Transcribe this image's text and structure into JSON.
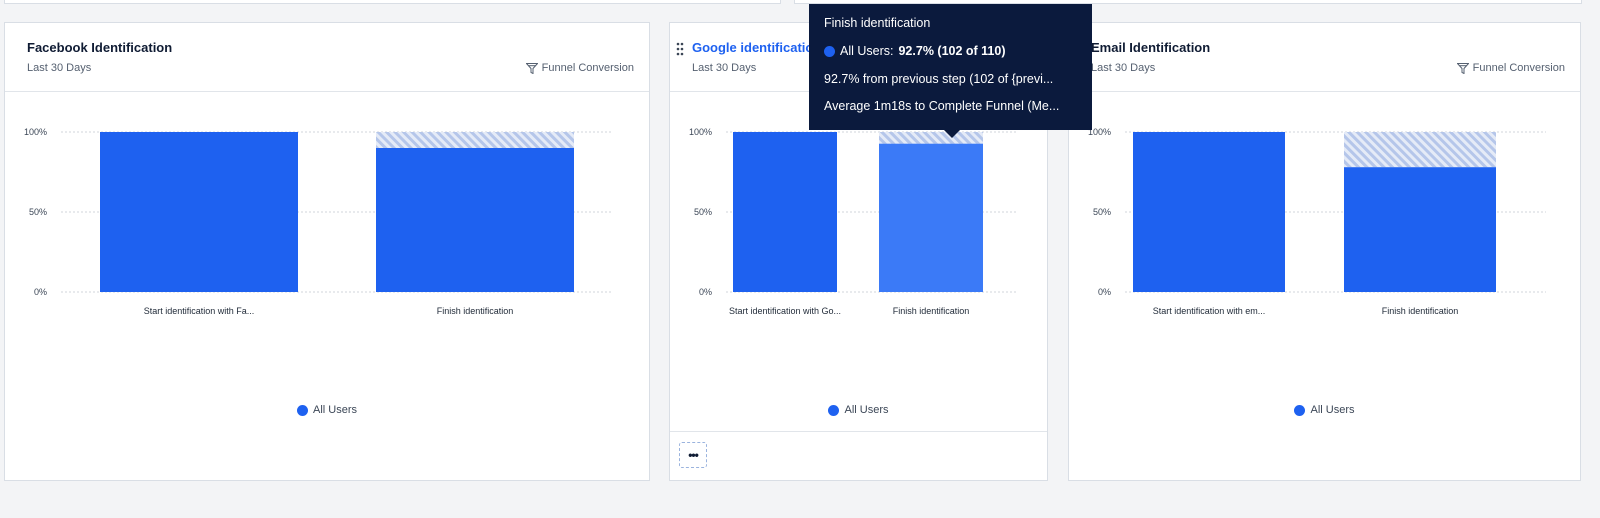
{
  "colors": {
    "bar": "#1e61f0",
    "bar_hover": "#3b7af7",
    "grid": "#d1d5db",
    "tooltip_bg": "#0b1a3d"
  },
  "cards": [
    {
      "title": "Facebook Identification",
      "subtitle": "Last 30 Days",
      "meta": "Funnel Conversion",
      "legend": "All Users",
      "chart_data": {
        "type": "bar",
        "categories": [
          "Start identification with Fa...",
          "Finish identification"
        ],
        "values": [
          100,
          90
        ],
        "yticks": [
          "100%",
          "50%",
          "0%"
        ],
        "ylim": [
          0,
          100
        ],
        "series": [
          {
            "name": "All Users",
            "values": [
              100,
              90
            ]
          }
        ]
      }
    },
    {
      "title": "Google identification",
      "subtitle": "Last 30 Days",
      "legend": "All Users",
      "more_label": "•••",
      "chart_data": {
        "type": "bar",
        "categories": [
          "Start identification with Go...",
          "Finish identification"
        ],
        "values": [
          100,
          92.7
        ],
        "yticks": [
          "100%",
          "50%",
          "0%"
        ],
        "ylim": [
          0,
          100
        ],
        "series": [
          {
            "name": "All Users",
            "values": [
              100,
              92.7
            ]
          }
        ]
      }
    },
    {
      "title": "Email Identification",
      "subtitle": "Last 30 Days",
      "meta": "Funnel Conversion",
      "legend": "All Users",
      "chart_data": {
        "type": "bar",
        "categories": [
          "Start identification with em...",
          "Finish identification"
        ],
        "values": [
          100,
          78
        ],
        "yticks": [
          "100%",
          "50%",
          "0%"
        ],
        "ylim": [
          0,
          100
        ],
        "series": [
          {
            "name": "All Users",
            "values": [
              100,
              78
            ]
          }
        ]
      }
    }
  ],
  "tooltip": {
    "title": "Finish identification",
    "series_label": "All Users:",
    "series_value": "92.7% (102 of 110)",
    "line2": "92.7% from previous step (102 of {previ...",
    "line3": "Average 1m18s to Complete Funnel (Me..."
  }
}
